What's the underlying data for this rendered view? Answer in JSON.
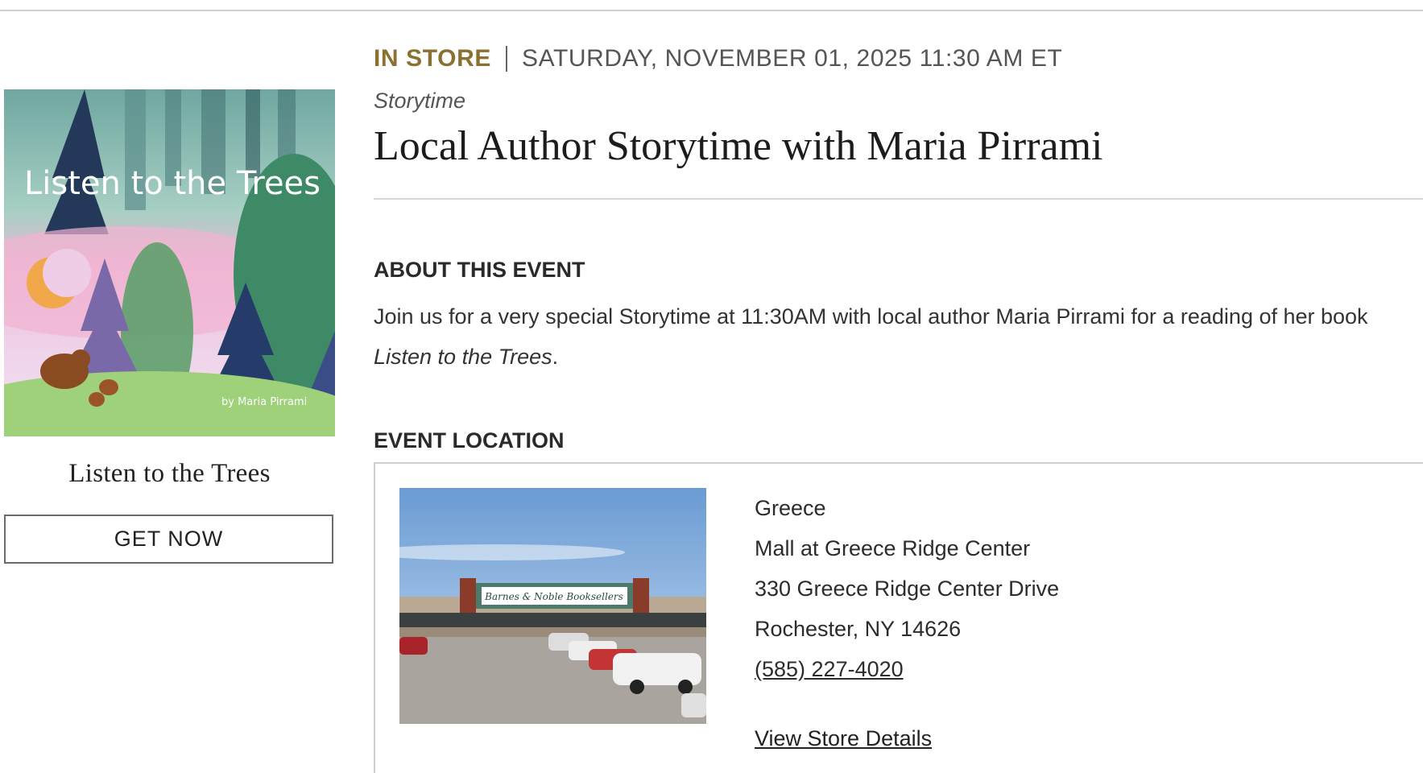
{
  "event": {
    "type_label": "IN STORE",
    "datetime": "SATURDAY, NOVEMBER 01, 2025 11:30 AM ET",
    "category": "Storytime",
    "title": "Local Author Storytime with Maria Pirrami"
  },
  "book": {
    "cover_title": "Listen to the Trees",
    "cover_author": "by Maria Pirrami",
    "title": "Listen to the Trees",
    "cta_label": "GET NOW"
  },
  "about": {
    "heading": "ABOUT THIS EVENT",
    "text_before": "Join us for a very special Storytime at 11:30AM with local author Maria Pirrami for a reading of her book ",
    "text_italic": "Listen to the Trees",
    "text_after": "."
  },
  "location": {
    "heading": "EVENT LOCATION",
    "photo_sign": "Barnes & Noble Booksellers",
    "store_name": "Greece",
    "mall": "Mall at Greece Ridge Center",
    "street": "330 Greece Ridge Center Drive",
    "city": "Rochester, NY 14626",
    "phone": "(585) 227-4020",
    "details_link": "View Store Details"
  },
  "colors": {
    "accent_gold": "#8b7131",
    "rule_gray": "#cfcfcf"
  }
}
